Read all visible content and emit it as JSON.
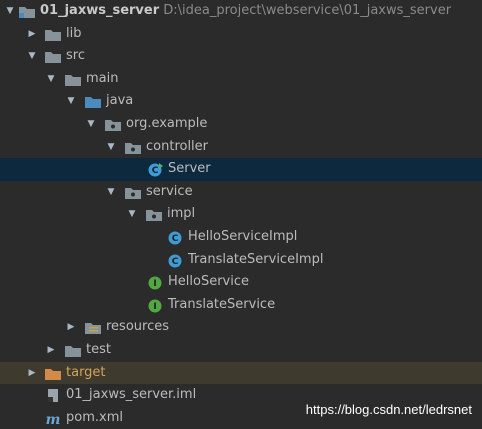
{
  "project": {
    "name": "01_jaxws_server",
    "path": "D:\\idea_project\\webservice\\01_jaxws_server"
  },
  "tree": {
    "lib": "lib",
    "src": "src",
    "main": "main",
    "java": "java",
    "package": "org.example",
    "controller": "controller",
    "server": "Server",
    "service": "service",
    "impl": "impl",
    "hello_impl": "HelloServiceImpl",
    "translate_impl": "TranslateServiceImpl",
    "hello_service": "HelloService",
    "translate_service": "TranslateService",
    "resources": "resources",
    "test": "test",
    "target": "target",
    "iml": "01_jaxws_server.iml",
    "pom": "pom.xml"
  },
  "watermark": "https://blog.csdn.net/ledrsnet",
  "colors": {
    "background": "#2b2b2b",
    "selection": "#0d293e",
    "excluded_row": "#3f3a2e",
    "folder": "#87939a",
    "source_folder": "#4b8bbe",
    "class_icon": "#3d9bd5",
    "interface_icon": "#51a843"
  }
}
